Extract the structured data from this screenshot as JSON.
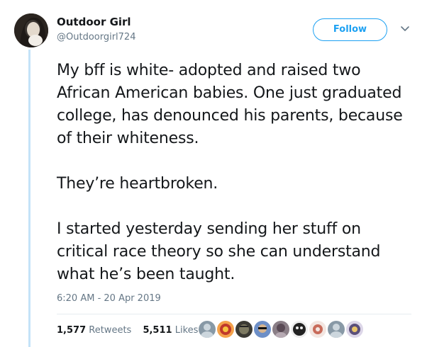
{
  "user": {
    "name": "Outdoor Girl",
    "handle": "@Outdoorgirl724"
  },
  "follow_label": "Follow",
  "tweet": {
    "paragraphs": [
      "My bff is white- adopted and raised two African American babies. One just graduated college, has denounced his parents, because of their whiteness.",
      "They’re heartbroken.",
      "I started yesterday sending her stuff on critical race theory so she can understand what he’s been taught."
    ],
    "timestamp": "6:20 AM - 20 Apr 2019"
  },
  "stats": {
    "retweets_count": "1,577",
    "retweets_label": "Retweets",
    "likes_count": "5,511",
    "likes_label": "Likes"
  },
  "colors": {
    "accent": "#1da1f2",
    "secondary_text": "#657786",
    "thread_line": "#c4e3f8"
  },
  "icons": [
    "chevron-down-icon"
  ]
}
